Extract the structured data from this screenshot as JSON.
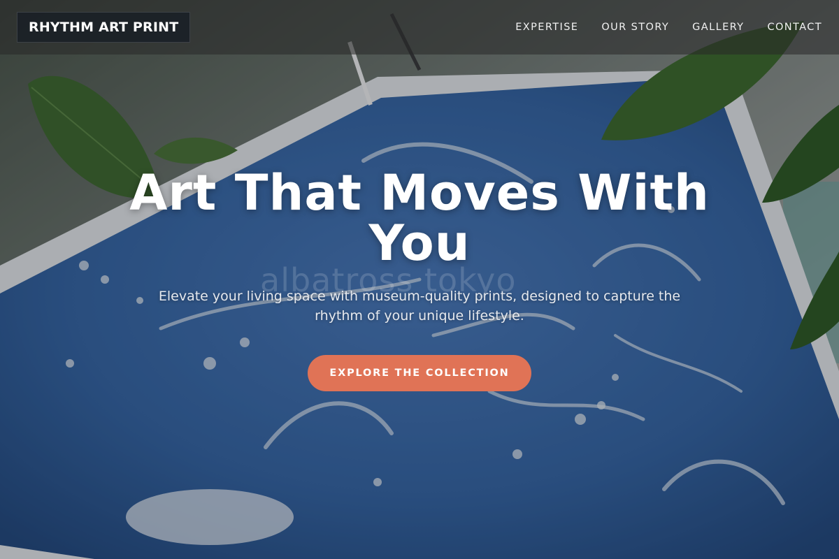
{
  "nav": {
    "brand": "RHYTHM ART PRINT",
    "links": [
      "EXPERTISE",
      "OUR STORY",
      "GALLERY",
      "CONTACT"
    ]
  },
  "hero": {
    "title": "Art That Moves With You",
    "subtitle": "Elevate your living space with museum-quality prints, designed to capture the rhythm of your unique lifestyle.",
    "cta_label": "EXPLORE THE COLLECTION",
    "watermark": "albatross tokyo"
  },
  "colors": {
    "accent": "#e07356",
    "nav_background": "#282828",
    "print_blue": "#3a6aa8"
  },
  "icons": [
    "leaf-icon"
  ]
}
